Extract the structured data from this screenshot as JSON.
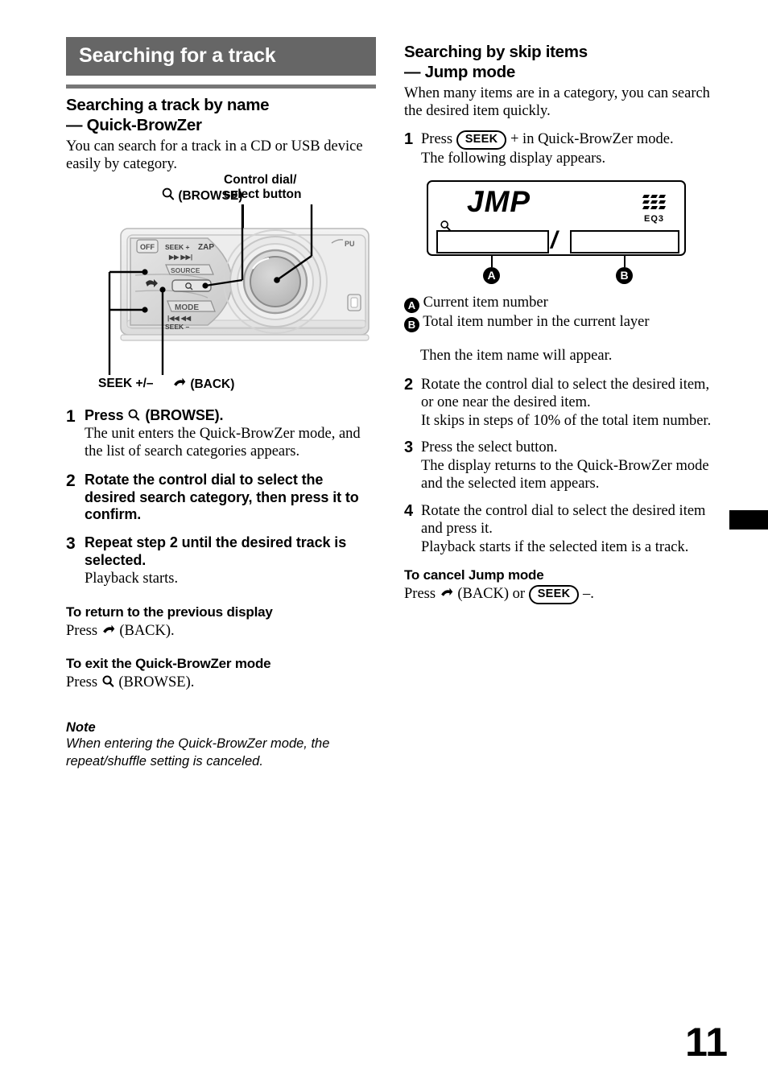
{
  "page": {
    "folio": "11",
    "section_banner": "Searching for a track"
  },
  "left_column": {
    "heading_line1": "Searching a track by name",
    "heading_line2": "— Quick-BrowZer",
    "intro": "You can search for a track in a CD or USB device easily by category.",
    "figure": {
      "label_browse": "(BROWSE)",
      "label_control_dial_line1": "Control dial/",
      "label_control_dial_line2": "select button",
      "label_seek": "SEEK +/–",
      "label_back": "(BACK)",
      "unit_keys": {
        "off": "OFF",
        "seek_plus": "SEEK +",
        "zap": "ZAP",
        "source": "SOURCE",
        "mode": "MODE",
        "seek_minus": "SEEK –",
        "fast_forward": "▶▶ ▶▶|",
        "rewind": "|◀◀ ◀◀",
        "pause_partial": "PU"
      }
    },
    "steps": [
      {
        "num": "1",
        "lead_prefix": "Press ",
        "lead_suffix": " (BROWSE).",
        "lead_icon": "magnifier-icon",
        "sub": "The unit enters the Quick-BrowZer mode, and the list of search categories appears."
      },
      {
        "num": "2",
        "lead_bold": "Rotate the control dial to select the desired search category, then press it to confirm.",
        "sub": ""
      },
      {
        "num": "3",
        "lead_bold": "Repeat step 2 until the desired track is selected.",
        "sub": "Playback starts."
      }
    ],
    "subsections": [
      {
        "title": "To return to the previous display",
        "body_prefix": "Press ",
        "body_icon": "back-arrow-icon",
        "body_suffix": " (BACK)."
      },
      {
        "title": "To exit the Quick-BrowZer mode",
        "body_prefix": "Press ",
        "body_icon": "magnifier-icon",
        "body_suffix": " (BROWSE)."
      }
    ],
    "note": {
      "title": "Note",
      "body": "When entering the Quick-BrowZer mode, the repeat/shuffle setting is canceled."
    }
  },
  "right_column": {
    "heading_line1": "Searching by skip items",
    "heading_line2": "— Jump mode",
    "intro": "When many items are in a category, you can search the desired item quickly.",
    "step1": {
      "num": "1",
      "lead_prefix": "Press ",
      "seek_key": "SEEK",
      "lead_suffix": " + in Quick-BrowZer mode.",
      "sub": "The following display appears."
    },
    "lcd": {
      "mode_text": "JMP",
      "separator": "/",
      "eq_label": "EQ3",
      "magnifier_icon": "magnifier-icon",
      "callout_a": "A",
      "callout_b": "B"
    },
    "legend": [
      {
        "badge": "A",
        "text": "Current item number"
      },
      {
        "badge": "B",
        "text": "Total item number in the current layer"
      }
    ],
    "after_legend": "Then the item name will appear.",
    "steps": [
      {
        "num": "2",
        "lead": "Rotate the control dial to select the desired item, or one near the desired item.",
        "sub": "It skips in steps of 10% of the total item number."
      },
      {
        "num": "3",
        "lead": "Press the select button.",
        "sub": "The display returns to the Quick-BrowZer mode and the selected item appears."
      },
      {
        "num": "4",
        "lead": "Rotate the control dial to select the desired item and press it.",
        "sub": "Playback starts if the selected item is a track."
      }
    ],
    "cancel": {
      "title": "To cancel Jump mode",
      "prefix": "Press ",
      "back_icon": "back-arrow-icon",
      "middle": " (BACK) or ",
      "seek_key": "SEEK",
      "suffix": " –."
    }
  },
  "colors": {
    "banner_bg": "#666666",
    "rule": "#777777",
    "text": "#000000"
  }
}
